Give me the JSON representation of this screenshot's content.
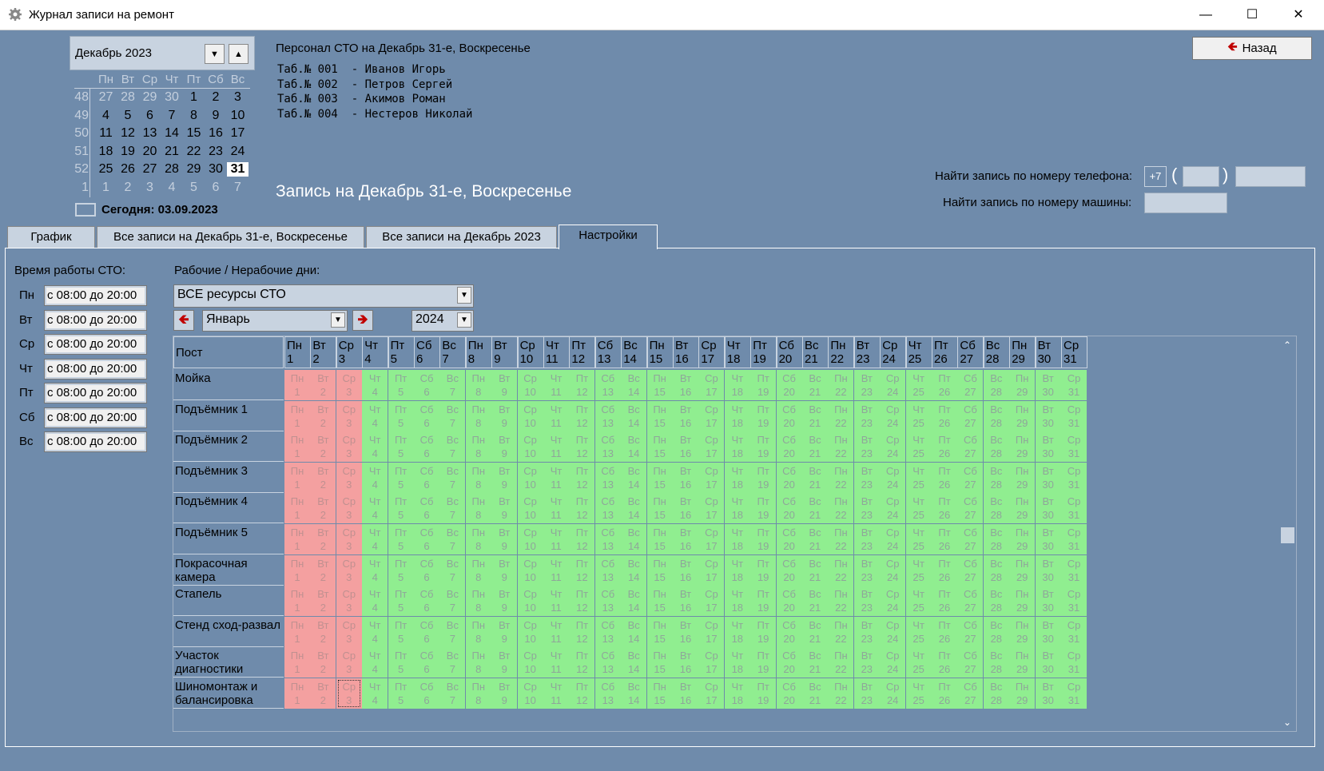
{
  "window": {
    "title": "Журнал записи на ремонт"
  },
  "calendar": {
    "month_label": "Декабрь 2023",
    "weekdays": [
      "Пн",
      "Вт",
      "Ср",
      "Чт",
      "Пт",
      "Сб",
      "Вс"
    ],
    "weeks": [
      {
        "wk": "48",
        "days": [
          "27",
          "28",
          "29",
          "30",
          "1",
          "2",
          "3"
        ]
      },
      {
        "wk": "49",
        "days": [
          "4",
          "5",
          "6",
          "7",
          "8",
          "9",
          "10"
        ]
      },
      {
        "wk": "50",
        "days": [
          "11",
          "12",
          "13",
          "14",
          "15",
          "16",
          "17"
        ]
      },
      {
        "wk": "51",
        "days": [
          "18",
          "19",
          "20",
          "21",
          "22",
          "23",
          "24"
        ]
      },
      {
        "wk": "52",
        "days": [
          "25",
          "26",
          "27",
          "28",
          "29",
          "30",
          "31"
        ]
      },
      {
        "wk": "1",
        "days": [
          "1",
          "2",
          "3",
          "4",
          "5",
          "6",
          "7"
        ]
      }
    ],
    "today_label": "Сегодня: 03.09.2023"
  },
  "staff": {
    "title": "Персонал СТО на Декабрь 31-е, Воскресенье",
    "list": [
      "Таб.№ 001  - Иванов Игорь",
      "Таб.№ 002  - Петров Сергей",
      "Таб.№ 003  - Акимов Роман",
      "Таб.№ 004  - Нестеров Николай"
    ]
  },
  "record_title": "Запись на Декабрь 31-е, Воскресенье",
  "back_button": {
    "label": "Назад",
    "icon": "left-arrow-icon"
  },
  "search": {
    "phone_label": "Найти запись по номеру телефона:",
    "phone_prefix": "+7",
    "car_label": "Найти запись по номеру машины:"
  },
  "tabs": [
    "График",
    "Все записи на Декабрь 31-е, Воскресенье",
    "Все записи на Декабрь 2023",
    "Настройки"
  ],
  "working_time": {
    "title": "Время работы СТО:",
    "rows": [
      {
        "day": "Пн",
        "value": "с 08:00 до 20:00"
      },
      {
        "day": "Вт",
        "value": "с 08:00 до 20:00"
      },
      {
        "day": "Ср",
        "value": "с 08:00 до 20:00"
      },
      {
        "day": "Чт",
        "value": "с 08:00 до 20:00"
      },
      {
        "day": "Пт",
        "value": "с 08:00 до 20:00"
      },
      {
        "day": "Сб",
        "value": "с 08:00 до 20:00"
      },
      {
        "day": "Вс",
        "value": "с 08:00 до 20:00"
      }
    ]
  },
  "days_settings": {
    "title": "Рабочие / Нерабочие дни:",
    "resource": "ВСЕ ресурсы СТО",
    "month": "Январь",
    "year": "2024",
    "post_header": "Пост",
    "day_names": [
      "Пн",
      "Вт",
      "Ср",
      "Чт",
      "Пт",
      "Сб",
      "Вс",
      "Пн",
      "Вт",
      "Ср",
      "Чт",
      "Пт",
      "Сб",
      "Вс",
      "Пн",
      "Вт",
      "Ср",
      "Чт",
      "Пт",
      "Сб",
      "Вс",
      "Пн",
      "Вт",
      "Ср",
      "Чт",
      "Пт",
      "Сб",
      "Вс",
      "Пн",
      "Вт",
      "Ср"
    ],
    "day_numbers": [
      "1",
      "2",
      "3",
      "4",
      "5",
      "6",
      "7",
      "8",
      "9",
      "10",
      "11",
      "12",
      "13",
      "14",
      "15",
      "16",
      "17",
      "18",
      "19",
      "20",
      "21",
      "22",
      "23",
      "24",
      "25",
      "26",
      "27",
      "28",
      "29",
      "30",
      "31"
    ],
    "non_working_days": [
      1,
      2,
      3
    ],
    "colors": {
      "working": "#90ee90",
      "non_working": "#f4a0a0"
    },
    "posts": [
      [
        "Мойка"
      ],
      [
        "Подъёмник 1"
      ],
      [
        "Подъёмник 2"
      ],
      [
        "Подъёмник 3"
      ],
      [
        "Подъёмник 4"
      ],
      [
        "Подъёмник 5"
      ],
      [
        "Покрасочная",
        "камера"
      ],
      [
        "Стапель"
      ],
      [
        "Стенд сход-развал"
      ],
      [
        "Участок",
        "диагностики"
      ],
      [
        "Шиномонтаж и",
        "балансировка"
      ]
    ]
  }
}
